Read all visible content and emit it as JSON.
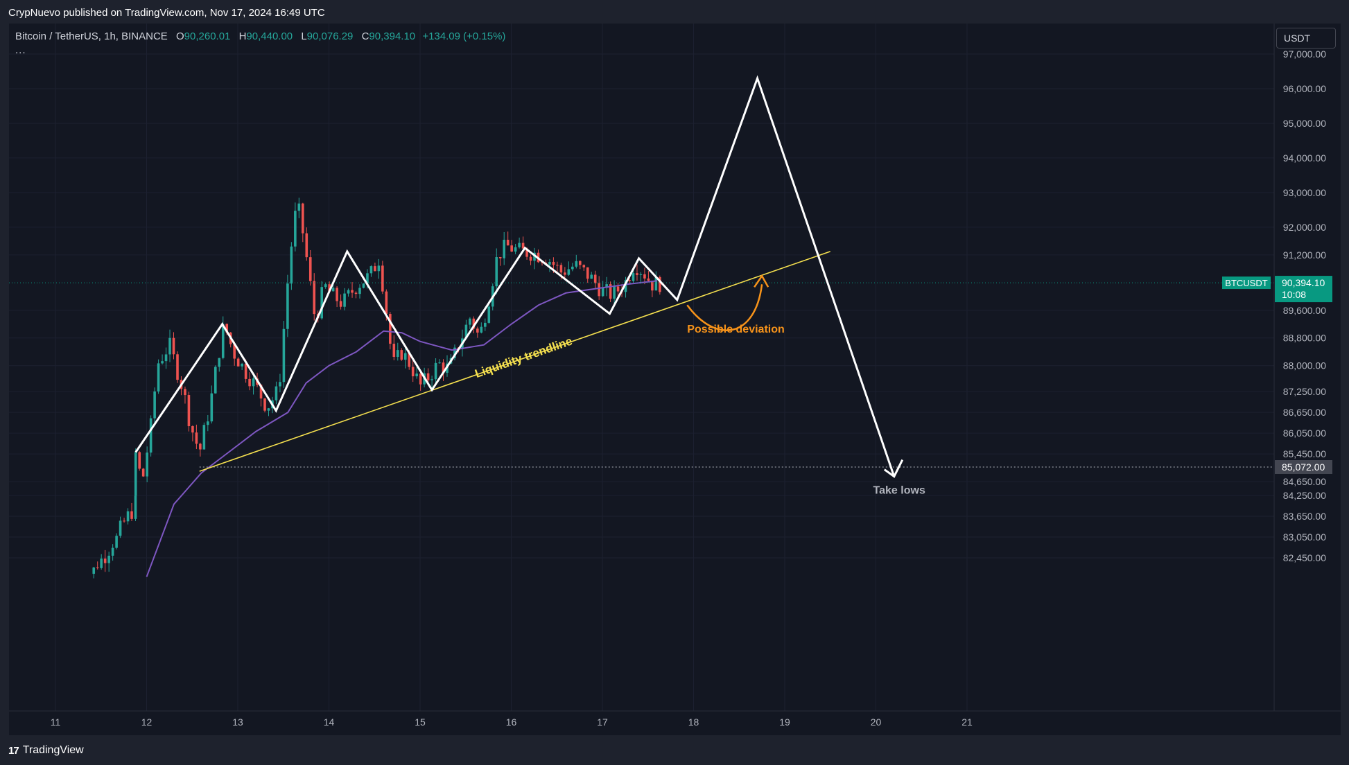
{
  "header": {
    "published": "CrypNuevo published on TradingView.com, Nov 17, 2024 16:49 UTC"
  },
  "legend": {
    "symbol": "Bitcoin / TetherUS, 1h, BINANCE",
    "open_label": "O",
    "open": "90,260.01",
    "high_label": "H",
    "high": "90,440.00",
    "low_label": "L",
    "low": "90,076.29",
    "close_label": "C",
    "close": "90,394.10",
    "change": "+134.09 (+0.15%)",
    "more": "..."
  },
  "currency": "USDT",
  "footer": {
    "brand": "TradingView",
    "logo_icon": "tradingview-logo-icon"
  },
  "colors": {
    "up": "#26a69a",
    "down": "#ef5350",
    "ma": "#7e57c2",
    "trendline": "#f5e04f",
    "deviation": "#f7931a",
    "path": "#ffffff",
    "price_tag": "#089981",
    "grid": "#1c2030"
  },
  "chart_data": {
    "type": "candlestick",
    "symbol": "BTCUSDT",
    "interval": "1h",
    "ylim": [
      81900,
      97700
    ],
    "xlim_days": [
      10.5,
      21.6
    ],
    "y_ticks": [
      {
        "value": 97000,
        "label": "97,000.00"
      },
      {
        "value": 96000,
        "label": "96,000.00"
      },
      {
        "value": 95000,
        "label": "95,000.00"
      },
      {
        "value": 94000,
        "label": "94,000.00"
      },
      {
        "value": 93000,
        "label": "93,000.00"
      },
      {
        "value": 92000,
        "label": "92,000.00"
      },
      {
        "value": 91200,
        "label": "91,200.00"
      },
      {
        "value": 89600,
        "label": "89,600.00"
      },
      {
        "value": 88800,
        "label": "88,800.00"
      },
      {
        "value": 88000,
        "label": "88,000.00"
      },
      {
        "value": 87250,
        "label": "87,250.00"
      },
      {
        "value": 86650,
        "label": "86,650.00"
      },
      {
        "value": 86050,
        "label": "86,050.00"
      },
      {
        "value": 85450,
        "label": "85,450.00"
      },
      {
        "value": 84650,
        "label": "84,650.00"
      },
      {
        "value": 84250,
        "label": "84,250.00"
      },
      {
        "value": 83650,
        "label": "83,650.00"
      },
      {
        "value": 83050,
        "label": "83,050.00"
      },
      {
        "value": 82450,
        "label": "82,450.00"
      }
    ],
    "x_ticks": [
      {
        "day": 11,
        "label": "11"
      },
      {
        "day": 12,
        "label": "12"
      },
      {
        "day": 13,
        "label": "13"
      },
      {
        "day": 14,
        "label": "14"
      },
      {
        "day": 15,
        "label": "15"
      },
      {
        "day": 16,
        "label": "16"
      },
      {
        "day": 17,
        "label": "17"
      },
      {
        "day": 18,
        "label": "18"
      },
      {
        "day": 19,
        "label": "19"
      },
      {
        "day": 20,
        "label": "20"
      },
      {
        "day": 21,
        "label": "21"
      }
    ],
    "current_price": {
      "value": 90394.1,
      "label": "90,394.10",
      "countdown": "10:08",
      "tag": "BTCUSDT"
    },
    "marked_level": {
      "value": 85072,
      "label": "85,072.00"
    },
    "price_path": [
      {
        "day": 11.88,
        "price": 85450
      },
      {
        "day": 11.95,
        "price": 84600
      },
      {
        "day": 12.05,
        "price": 86300
      },
      {
        "day": 12.12,
        "price": 88050
      },
      {
        "day": 12.25,
        "price": 88600
      },
      {
        "day": 12.32,
        "price": 88000
      },
      {
        "day": 12.4,
        "price": 87300
      },
      {
        "day": 12.48,
        "price": 86300
      },
      {
        "day": 12.58,
        "price": 85500
      },
      {
        "day": 12.7,
        "price": 86900
      },
      {
        "day": 12.78,
        "price": 88200
      },
      {
        "day": 12.85,
        "price": 89200
      },
      {
        "day": 12.95,
        "price": 88400
      },
      {
        "day": 13.08,
        "price": 87850
      },
      {
        "day": 13.2,
        "price": 87400
      },
      {
        "day": 13.32,
        "price": 86800
      },
      {
        "day": 13.45,
        "price": 87300
      },
      {
        "day": 13.55,
        "price": 90500
      },
      {
        "day": 13.62,
        "price": 92300
      },
      {
        "day": 13.68,
        "price": 92450
      },
      {
        "day": 13.75,
        "price": 91200
      },
      {
        "day": 13.85,
        "price": 89300
      },
      {
        "day": 13.95,
        "price": 90300
      },
      {
        "day": 14.05,
        "price": 90000
      },
      {
        "day": 14.15,
        "price": 89800
      },
      {
        "day": 14.3,
        "price": 90300
      },
      {
        "day": 14.45,
        "price": 90600
      },
      {
        "day": 14.55,
        "price": 91100
      },
      {
        "day": 14.62,
        "price": 89800
      },
      {
        "day": 14.7,
        "price": 88000
      },
      {
        "day": 14.8,
        "price": 88400
      },
      {
        "day": 14.9,
        "price": 88000
      },
      {
        "day": 15.0,
        "price": 87400
      },
      {
        "day": 15.1,
        "price": 87700
      },
      {
        "day": 15.2,
        "price": 88050
      },
      {
        "day": 15.32,
        "price": 87900
      },
      {
        "day": 15.42,
        "price": 88600
      },
      {
        "day": 15.55,
        "price": 89400
      },
      {
        "day": 15.65,
        "price": 88800
      },
      {
        "day": 15.75,
        "price": 89900
      },
      {
        "day": 15.85,
        "price": 91200
      },
      {
        "day": 15.95,
        "price": 91450
      },
      {
        "day": 16.1,
        "price": 91300
      },
      {
        "day": 16.25,
        "price": 91250
      },
      {
        "day": 16.4,
        "price": 91100
      },
      {
        "day": 16.55,
        "price": 90700
      },
      {
        "day": 16.7,
        "price": 90900
      },
      {
        "day": 16.85,
        "price": 90600
      },
      {
        "day": 17.0,
        "price": 90150
      },
      {
        "day": 17.12,
        "price": 90050
      },
      {
        "day": 17.25,
        "price": 90400
      },
      {
        "day": 17.35,
        "price": 90950
      },
      {
        "day": 17.45,
        "price": 90700
      },
      {
        "day": 17.55,
        "price": 90350
      },
      {
        "day": 17.67,
        "price": 90394
      }
    ],
    "moving_average": [
      {
        "day": 12.0,
        "price": 81900
      },
      {
        "day": 12.3,
        "price": 84000
      },
      {
        "day": 12.6,
        "price": 84900
      },
      {
        "day": 12.9,
        "price": 85500
      },
      {
        "day": 13.2,
        "price": 86100
      },
      {
        "day": 13.55,
        "price": 86650
      },
      {
        "day": 13.75,
        "price": 87500
      },
      {
        "day": 14.0,
        "price": 88000
      },
      {
        "day": 14.3,
        "price": 88400
      },
      {
        "day": 14.6,
        "price": 89000
      },
      {
        "day": 14.8,
        "price": 88950
      },
      {
        "day": 15.0,
        "price": 88700
      },
      {
        "day": 15.35,
        "price": 88450
      },
      {
        "day": 15.7,
        "price": 88600
      },
      {
        "day": 16.0,
        "price": 89200
      },
      {
        "day": 16.3,
        "price": 89750
      },
      {
        "day": 16.6,
        "price": 90100
      },
      {
        "day": 17.0,
        "price": 90250
      },
      {
        "day": 17.3,
        "price": 90360
      },
      {
        "day": 17.6,
        "price": 90450
      }
    ],
    "annotations": {
      "liquidity_trendline": {
        "label": "Liquidity trendline",
        "from": {
          "day": 12.58,
          "price": 84950
        },
        "to": {
          "day": 19.5,
          "price": 91300
        }
      },
      "zigzag": [
        {
          "day": 11.88,
          "price": 85500
        },
        {
          "day": 12.83,
          "price": 89200
        },
        {
          "day": 13.42,
          "price": 86700
        },
        {
          "day": 14.2,
          "price": 91300
        },
        {
          "day": 15.13,
          "price": 87300
        },
        {
          "day": 16.15,
          "price": 91400
        },
        {
          "day": 17.08,
          "price": 89500
        },
        {
          "day": 17.4,
          "price": 91100
        },
        {
          "day": 17.82,
          "price": 89900
        },
        {
          "day": 18.7,
          "price": 96300
        },
        {
          "day": 20.2,
          "price": 84800
        }
      ],
      "possible_deviation": {
        "label": "Possible deviation"
      },
      "take_lows": {
        "label": "Take lows"
      }
    }
  }
}
